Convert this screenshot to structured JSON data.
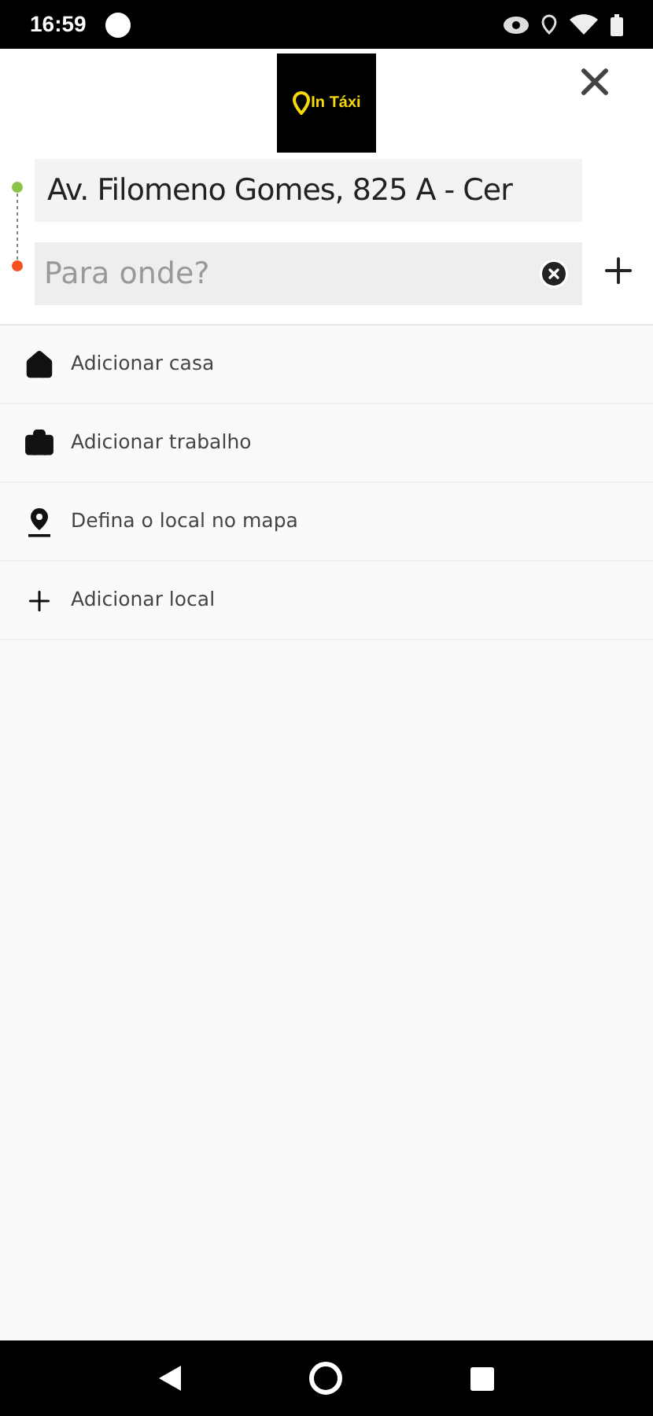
{
  "status_bar": {
    "time": "16:59"
  },
  "header": {
    "logo_text": "In Táxi"
  },
  "route": {
    "origin": {
      "value": "Av. Filomeno Gomes, 825 A - Cer"
    },
    "destination": {
      "placeholder": "Para onde?"
    }
  },
  "shortcuts": [
    {
      "kind": "home",
      "label": "Adicionar casa"
    },
    {
      "kind": "work",
      "label": "Adicionar trabalho"
    },
    {
      "kind": "pin",
      "label": "Defina o local no mapa"
    },
    {
      "kind": "add",
      "label": "Adicionar local"
    }
  ]
}
